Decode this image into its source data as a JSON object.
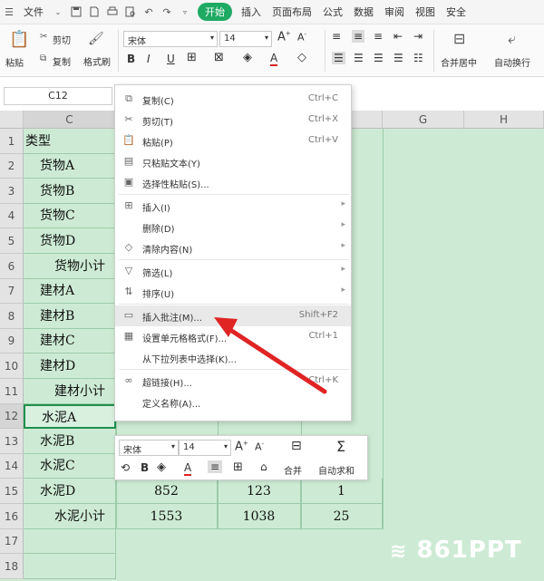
{
  "menubar": {
    "file": "文件",
    "tabs": [
      "开始",
      "插入",
      "页面布局",
      "公式",
      "数据",
      "审阅",
      "视图",
      "安全"
    ]
  },
  "ribbon": {
    "paste": "粘贴",
    "cut": "剪切",
    "copy": "复制",
    "format_painter": "格式刷",
    "font_name": "宋体",
    "font_size": "14",
    "merge_center": "合并居中",
    "auto_wrap": "自动换行"
  },
  "namebox": "C12",
  "columns": {
    "c": "C",
    "g": "G",
    "h": "H"
  },
  "rows": [
    {
      "num": "1",
      "label": "类型",
      "indent": 0
    },
    {
      "num": "2",
      "label": "货物A",
      "indent": 1
    },
    {
      "num": "3",
      "label": "货物B",
      "indent": 1
    },
    {
      "num": "4",
      "label": "货物C",
      "indent": 1
    },
    {
      "num": "5",
      "label": "货物D",
      "indent": 1
    },
    {
      "num": "6",
      "label": "货物小计",
      "indent": 2
    },
    {
      "num": "7",
      "label": "建材A",
      "indent": 1
    },
    {
      "num": "8",
      "label": "建材B",
      "indent": 1
    },
    {
      "num": "9",
      "label": "建材C",
      "indent": 1
    },
    {
      "num": "10",
      "label": "建材D",
      "indent": 1
    },
    {
      "num": "11",
      "label": "建材小计",
      "indent": 2
    },
    {
      "num": "12",
      "label": "水泥A",
      "indent": 1
    },
    {
      "num": "13",
      "label": "水泥B",
      "indent": 1
    },
    {
      "num": "14",
      "label": "水泥C",
      "indent": 1
    },
    {
      "num": "15",
      "label": "水泥D",
      "indent": 1
    },
    {
      "num": "16",
      "label": "水泥小计",
      "indent": 2
    },
    {
      "num": "17",
      "label": "",
      "indent": 0
    },
    {
      "num": "18",
      "label": "",
      "indent": 0
    }
  ],
  "values": {
    "r15": [
      "852",
      "123",
      "1"
    ],
    "r16": [
      "1553",
      "1038",
      "25"
    ]
  },
  "context_menu": [
    {
      "icon": "copy-icon",
      "label": "复制(C)",
      "shortcut": "Ctrl+C",
      "submenu": false
    },
    {
      "icon": "cut-icon",
      "label": "剪切(T)",
      "shortcut": "Ctrl+X",
      "submenu": false
    },
    {
      "icon": "paste-icon",
      "label": "粘贴(P)",
      "shortcut": "Ctrl+V",
      "submenu": false
    },
    {
      "icon": "paste-text-icon",
      "label": "只粘贴文本(Y)",
      "shortcut": "",
      "submenu": false
    },
    {
      "icon": "paste-special-icon",
      "label": "选择性粘贴(S)...",
      "shortcut": "",
      "submenu": false
    },
    {
      "icon": "insert-icon",
      "label": "插入(I)",
      "shortcut": "",
      "submenu": true
    },
    {
      "icon": "",
      "label": "删除(D)",
      "shortcut": "",
      "submenu": true
    },
    {
      "icon": "eraser-icon",
      "label": "清除内容(N)",
      "shortcut": "",
      "submenu": true
    },
    {
      "icon": "filter-icon",
      "label": "筛选(L)",
      "shortcut": "",
      "submenu": true
    },
    {
      "icon": "sort-icon",
      "label": "排序(U)",
      "shortcut": "",
      "submenu": true
    },
    {
      "icon": "comment-icon",
      "label": "插入批注(M)...",
      "shortcut": "Shift+F2",
      "submenu": false
    },
    {
      "icon": "format-cells-icon",
      "label": "设置单元格格式(F)...",
      "shortcut": "Ctrl+1",
      "submenu": false
    },
    {
      "icon": "",
      "label": "从下拉列表中选择(K)...",
      "shortcut": "",
      "submenu": false
    },
    {
      "icon": "link-icon",
      "label": "超链接(H)...",
      "shortcut": "Ctrl+K",
      "submenu": false
    },
    {
      "icon": "",
      "label": "定义名称(A)...",
      "shortcut": "",
      "submenu": false
    }
  ],
  "mini_toolbar": {
    "font_name": "宋体",
    "font_size": "14",
    "merge": "合并",
    "autosum": "自动求和"
  },
  "watermark": "861PPT",
  "colors": {
    "accent": "#1eaa63",
    "sheet_bg": "#cdebd4",
    "arrow": "#e02424"
  }
}
